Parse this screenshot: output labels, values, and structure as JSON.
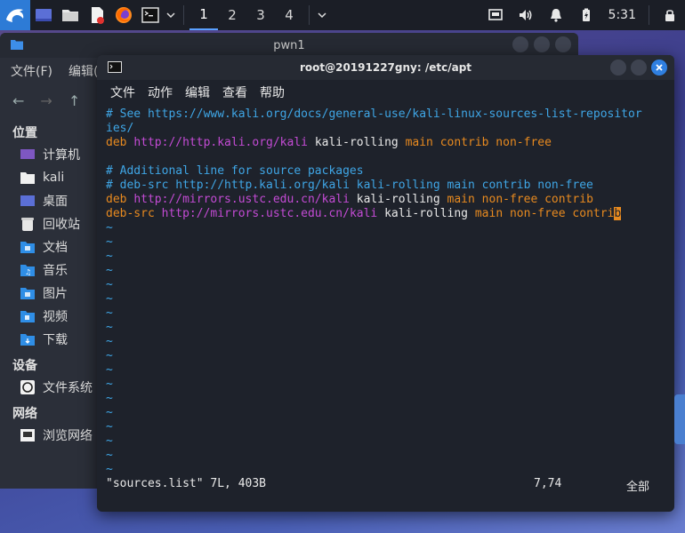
{
  "panel": {
    "workspaces": [
      "1",
      "2",
      "3",
      "4"
    ],
    "active_workspace": "1",
    "clock": "5:31",
    "accent": "#2d7bd6"
  },
  "file_manager": {
    "title": "pwn1",
    "menu": [
      "文件(F)",
      "编辑("
    ],
    "sidebar": {
      "places_header": "位置",
      "places": [
        "计算机",
        "kali",
        "桌面",
        "回收站",
        "文档",
        "音乐",
        "图片",
        "视频",
        "下载"
      ],
      "devices_header": "设备",
      "devices": [
        "文件系统"
      ],
      "network_header": "网络",
      "network": [
        "浏览网络"
      ]
    }
  },
  "terminal": {
    "title": "root@20191227gny: /etc/apt",
    "menu": [
      "文件",
      "动作",
      "编辑",
      "查看",
      "帮助"
    ],
    "lines": {
      "l1": "# See https://www.kali.org/docs/general-use/kali-linux-sources-list-repositor",
      "l2": "ies/",
      "l3_kw": "deb",
      "l3_url": "http://http.kali.org/kali",
      "l3_dist": "kali-rolling",
      "l3_comp": "main contrib non-free",
      "l5": "# Additional line for source packages",
      "l6": "# deb-src http://http.kali.org/kali kali-rolling main contrib non-free",
      "l7_kw": "deb",
      "l7_url": "http://mirrors.ustc.edu.cn/kali",
      "l7_dist": "kali-rolling",
      "l7_comp": "main non-free contrib",
      "l8_kw": "deb-src",
      "l8_url": "http://mirrors.ustc.edu.cn/kali",
      "l8_dist": "kali-rolling",
      "l8_comp": "main non-free contri",
      "l8_cursor": "b",
      "tilde": "~"
    },
    "status": {
      "file": "\"sources.list\" 7L, 403B",
      "position": "7,74",
      "percent": "全部"
    }
  }
}
